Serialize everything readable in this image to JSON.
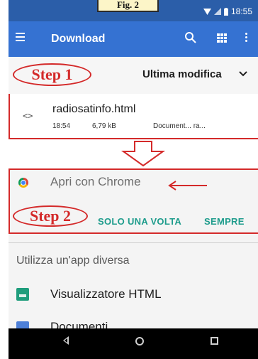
{
  "figure_label": "Fig. 2",
  "status_bar": {
    "time": "18:55"
  },
  "app_bar": {
    "title": "Download"
  },
  "sort": {
    "label": "Ultima modifica"
  },
  "annotations": {
    "step1": "Step 1",
    "step2": "Step 2"
  },
  "file": {
    "name": "radiosatinfo.html",
    "time": "18:54",
    "size": "6,79 kB",
    "kind": "Document... ra..."
  },
  "chooser": {
    "open_with": "Apri con Chrome",
    "just_once": "SOLO UNA VOLTA",
    "always": "SEMPRE",
    "other_app_heading": "Utilizza un'app diversa",
    "apps": [
      {
        "label": "Visualizzatore HTML",
        "icon": "html-viewer-icon"
      },
      {
        "label": "Documenti",
        "icon": "documents-icon"
      }
    ]
  },
  "colors": {
    "app_bar": "#3572d2",
    "status_bar": "#2b5ea9",
    "annotation_red": "#d42a2a",
    "action_teal": "#1e9c8c"
  }
}
